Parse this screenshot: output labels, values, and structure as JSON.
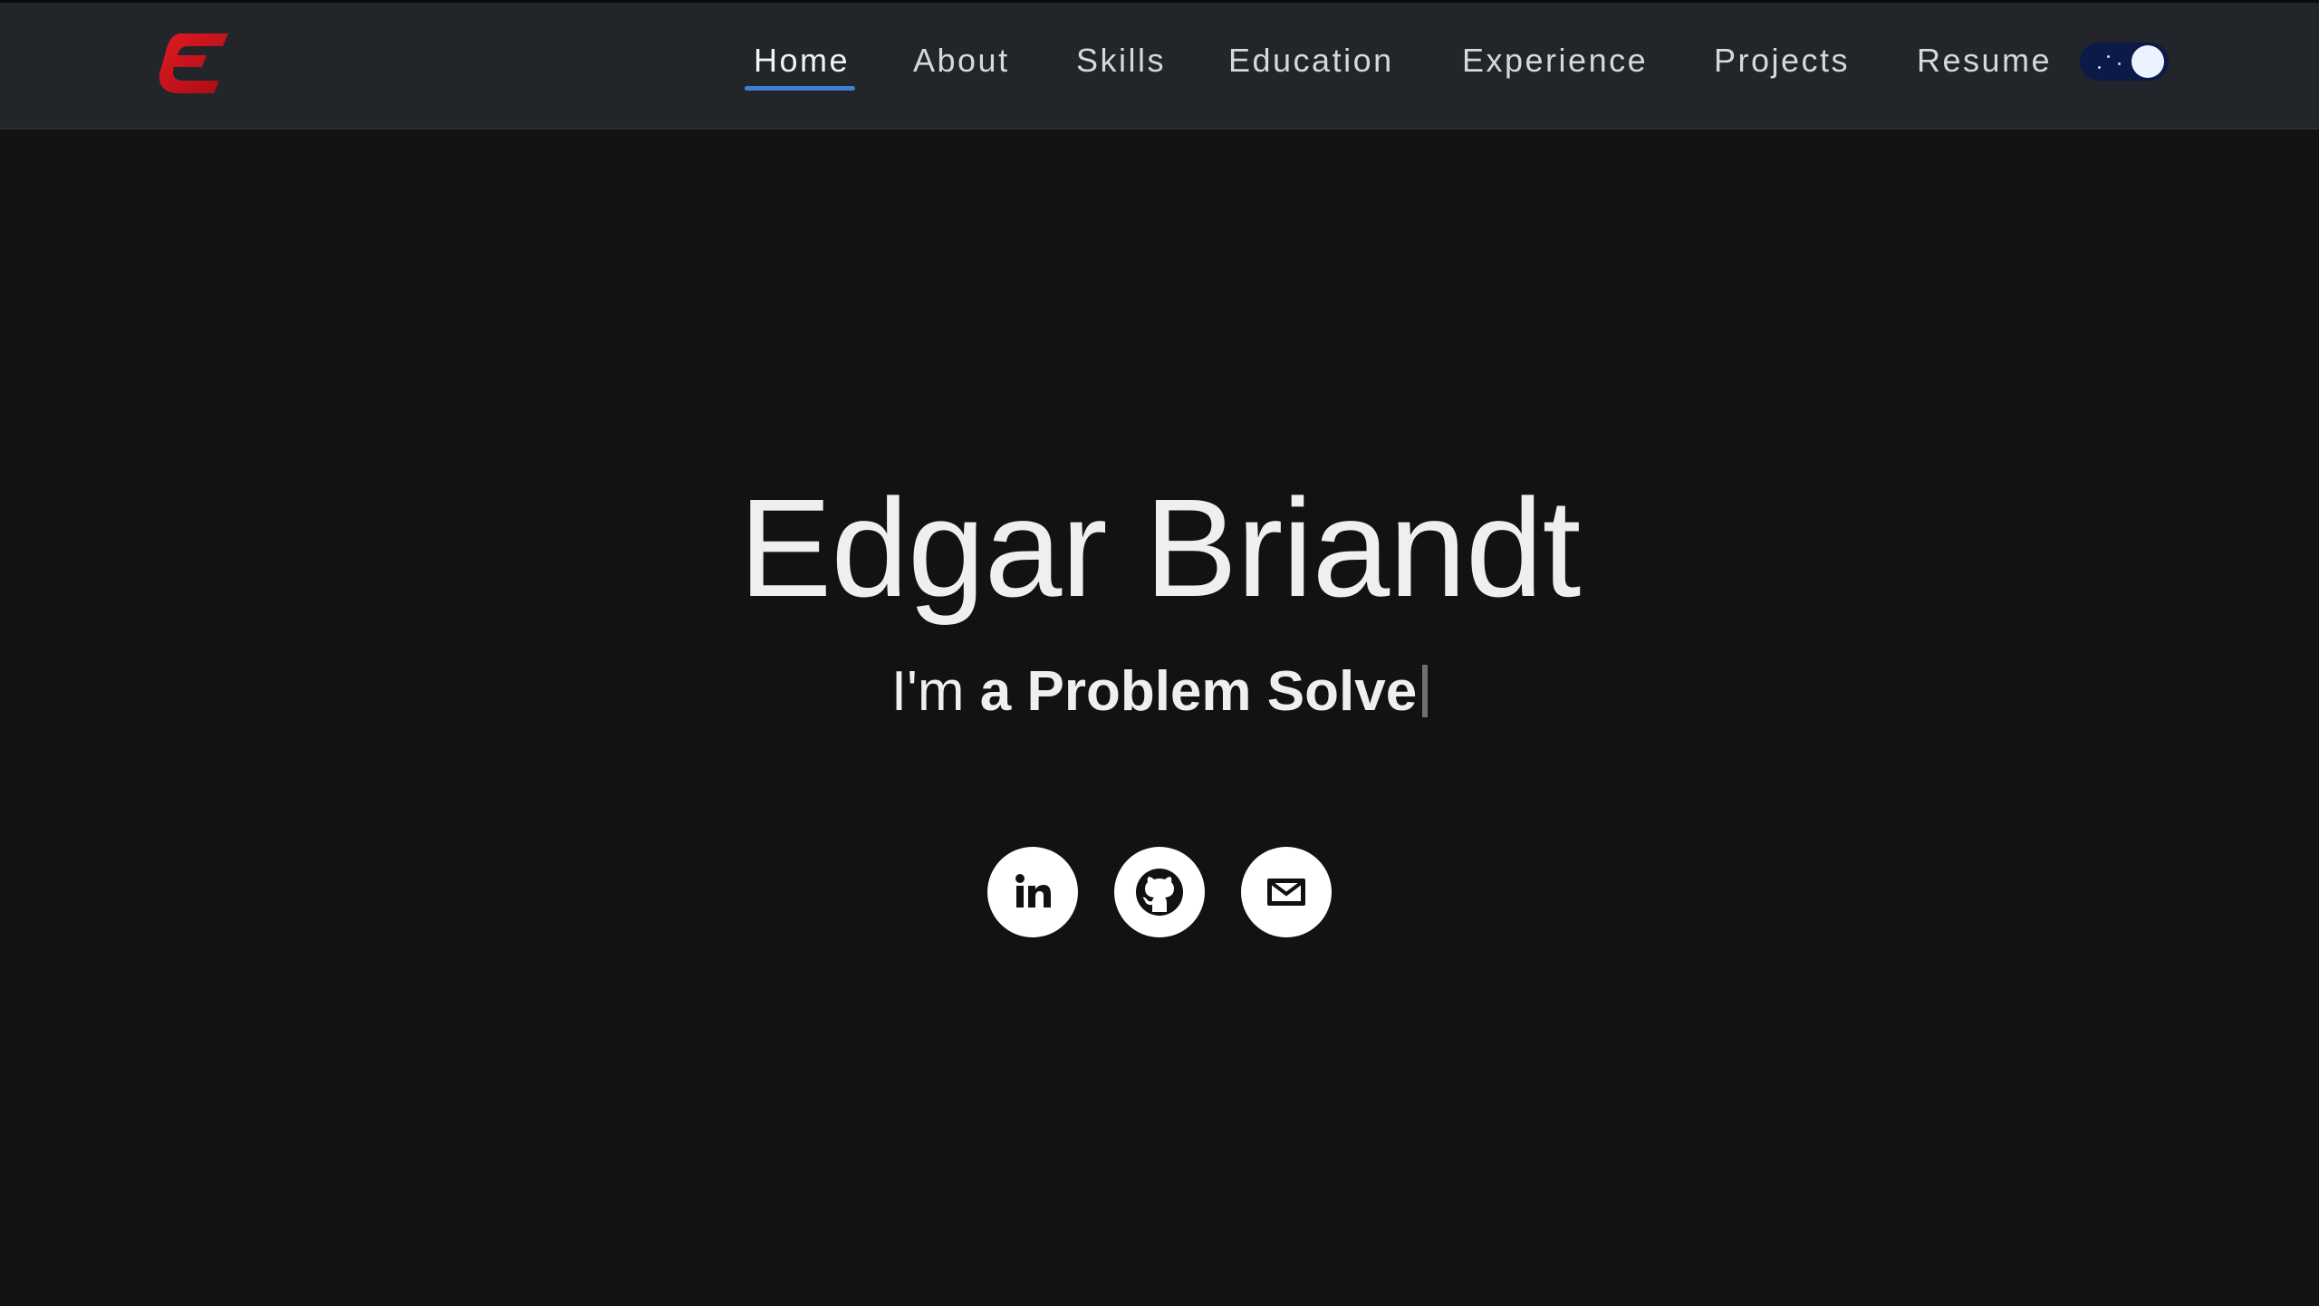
{
  "colors": {
    "background": "#121212",
    "navbar": "#22252a",
    "accent": "#3f7fd4",
    "logo": "#d0121b",
    "text": "#efefef"
  },
  "header": {
    "logo_icon": "letter-e-logo",
    "nav": [
      {
        "label": "Home",
        "active": true
      },
      {
        "label": "About",
        "active": false
      },
      {
        "label": "Skills",
        "active": false
      },
      {
        "label": "Education",
        "active": false
      },
      {
        "label": "Experience",
        "active": false
      },
      {
        "label": "Projects",
        "active": false
      },
      {
        "label": "Resume",
        "active": false
      }
    ],
    "theme_toggle": {
      "icon": "theme-toggle-icon",
      "state": "dark"
    }
  },
  "hero": {
    "name": "Edgar Briandt",
    "tagline_prefix": "I'm",
    "tagline_typed": "a Problem Solve"
  },
  "socials": [
    {
      "icon": "linkedin-icon"
    },
    {
      "icon": "github-icon"
    },
    {
      "icon": "mail-icon"
    }
  ]
}
